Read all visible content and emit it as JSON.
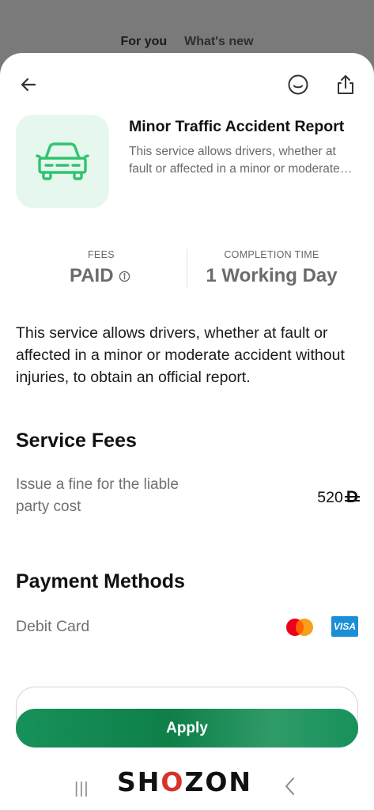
{
  "background_tabs": [
    "For you",
    "What's new"
  ],
  "header": {
    "back_icon": "arrow-left-icon",
    "smile_icon": "smiley-feedback-icon",
    "share_icon": "share-icon"
  },
  "service": {
    "icon": "car-icon",
    "title": "Minor Traffic Accident Report",
    "description": "This service allows drivers, whether at fault or affected in a minor or moderate accident without injuries, to obtain an official report."
  },
  "stats": {
    "fees_label": "FEES",
    "fees_value": "PAID",
    "time_label": "COMPLETION TIME",
    "time_value": "1 Working Day"
  },
  "long_description": "This service allows drivers, whether at fault or affected in a minor or moderate accident without injuries, to obtain an official report.",
  "service_fees": {
    "title": "Service Fees",
    "items": [
      {
        "label": "Issue a fine for the liable party cost",
        "amount": "520",
        "currency_symbol": "D"
      }
    ]
  },
  "payment_methods": {
    "title": "Payment Methods",
    "items": [
      {
        "label": "Debit Card",
        "brands": [
          "mastercard",
          "VISA"
        ]
      }
    ]
  },
  "apply_label": "Apply",
  "watermark": {
    "text_pre": "SH",
    "text_o": "O",
    "text_post": "ZON"
  },
  "colors": {
    "accent": "#17915b",
    "tile_bg": "#e6f8ee",
    "icon_green": "#2fc46f"
  }
}
